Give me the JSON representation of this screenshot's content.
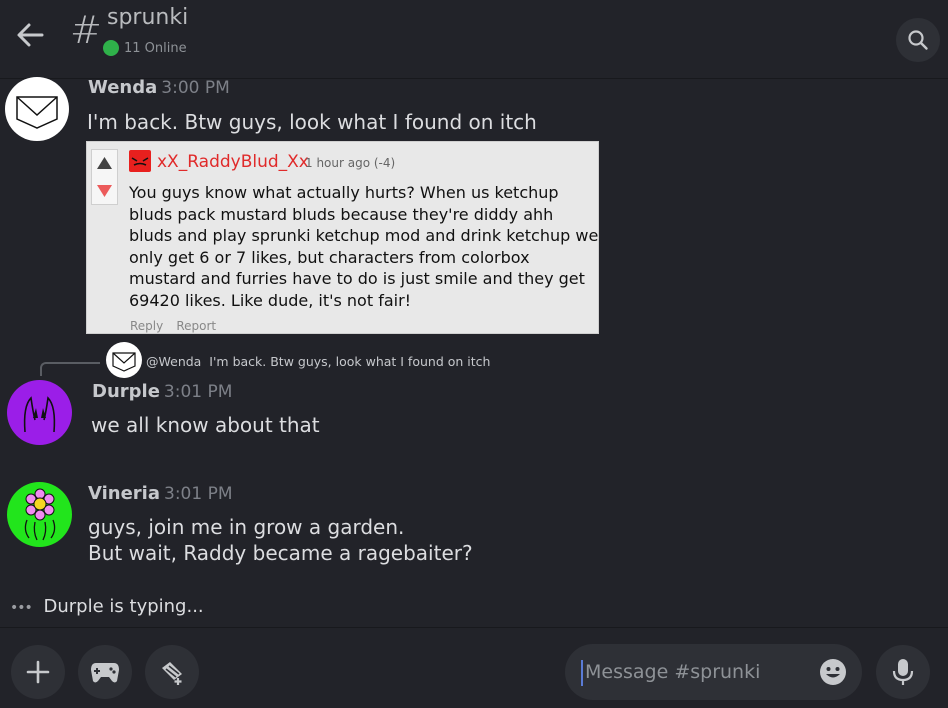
{
  "header": {
    "channel_hash": "#",
    "channel_name": "sprunki",
    "online_status": "11 Online"
  },
  "messages": [
    {
      "author": "Wenda",
      "time": "3:00 PM",
      "text": "I'm back. Btw guys, look what I found on itch"
    },
    {
      "author": "Durple",
      "time": "3:01 PM",
      "text": "we all know about that"
    },
    {
      "author": "Vineria",
      "time": "3:01 PM",
      "lines": [
        "guys, join me in grow a garden.",
        "But wait, Raddy became a ragebaiter?"
      ]
    }
  ],
  "embed": {
    "author": "xX_RaddyBlud_Xx",
    "time_ago": "1 hour ago (-4)",
    "body": "You guys know what actually hurts? When us ketchup bluds pack mustard bluds because they're diddy ahh bluds and play sprunki ketchup mod and drink ketchup we only get 6 or 7 likes, but characters from colorbox mustard and furries have to do is just smile and they get 69420 likes. Like dude, it's not fair!",
    "reply_label": "Reply",
    "report_label": "Report"
  },
  "reply_preview": {
    "mention": "@Wenda",
    "text": "I'm back. Btw guys, look what I found on itch"
  },
  "typing_indicator": "Durple is typing...",
  "composer": {
    "placeholder": "Message #sprunki"
  },
  "colors": {
    "background": "#222329",
    "online": "#2fb14a",
    "durple_avatar": "#9b1ee8",
    "vineria_avatar": "#22e51c",
    "embed_author": "#e02a2a"
  }
}
